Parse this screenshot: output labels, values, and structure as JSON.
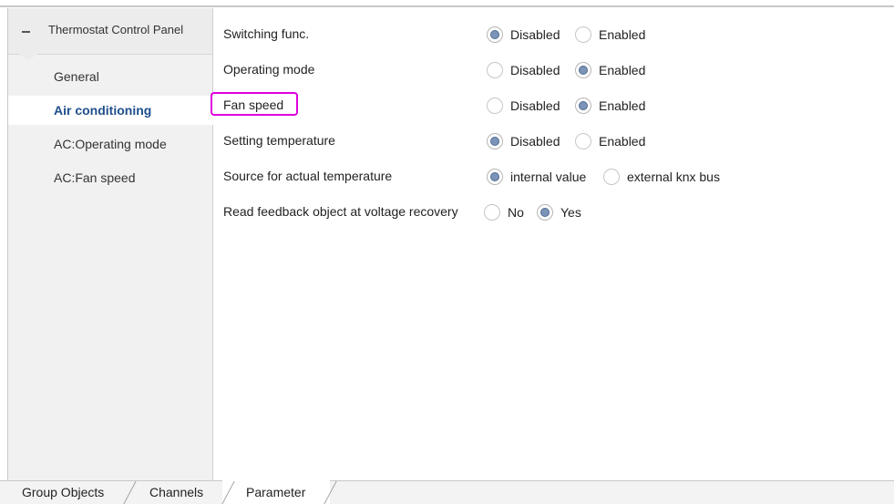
{
  "tree": {
    "root_label": "Thermostat Control Panel",
    "items": [
      {
        "label": "General"
      },
      {
        "label": "Air conditioning"
      },
      {
        "label": "AC:Operating mode"
      },
      {
        "label": "AC:Fan speed"
      }
    ],
    "active_item": "Air conditioning"
  },
  "parameters": [
    {
      "label": "Switching func.",
      "options": [
        "Disabled",
        "Enabled"
      ],
      "selected": "Disabled"
    },
    {
      "label": "Operating mode",
      "options": [
        "Disabled",
        "Enabled"
      ],
      "selected": "Enabled"
    },
    {
      "label": "Fan speed",
      "options": [
        "Disabled",
        "Enabled"
      ],
      "selected": "Enabled"
    },
    {
      "label": "Setting temperature",
      "options": [
        "Disabled",
        "Enabled"
      ],
      "selected": "Disabled"
    },
    {
      "label": "Source for actual temperature",
      "options": [
        "internal value",
        "external knx bus"
      ],
      "selected": "internal value"
    },
    {
      "label": "Read feedback object at voltage recovery",
      "options": [
        "No",
        "Yes"
      ],
      "selected": "Yes"
    }
  ],
  "highlighted_parameter": "Fan speed",
  "colors": {
    "highlight": "#e000e0",
    "active_text": "#1f4e8c",
    "radio_dot": "#7b94b8"
  },
  "tabs": [
    {
      "label": "Group Objects"
    },
    {
      "label": "Channels"
    },
    {
      "label": "Parameter"
    }
  ],
  "active_tab": "Parameter"
}
